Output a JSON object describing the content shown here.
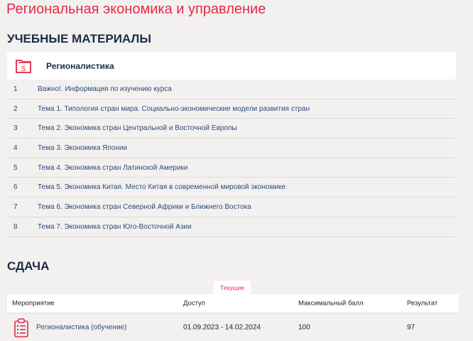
{
  "page_title": "Региональная экономика и управление",
  "materials": {
    "heading": "УЧЕБНЫЕ МАТЕРИАЛЫ",
    "course": "Регионалистика",
    "items": [
      {
        "n": "1",
        "label": "Важно!. Информация по изучению курса"
      },
      {
        "n": "2",
        "label": "Тема 1. Типология стран мира. Социально-экономические модели развития стран"
      },
      {
        "n": "3",
        "label": "Тема 2. Экономика стран Центральной и Восточной Европы"
      },
      {
        "n": "4",
        "label": "Тема 3. Экономика Японии"
      },
      {
        "n": "5",
        "label": "Тема 4. Экономика стран Латинской Америки"
      },
      {
        "n": "6",
        "label": "Тема 5. Экономика Китая. Место Китая в современной мировой экономике"
      },
      {
        "n": "7",
        "label": "Тема 6. Экономика стран Северной Африки и Ближнего Востока"
      },
      {
        "n": "8",
        "label": "Тема 7. Экономика стран Юго-Восточной Азии"
      }
    ]
  },
  "submission": {
    "heading": "СДАЧА",
    "tab": "Текущие",
    "columns": [
      "Мероприятие",
      "Доступ",
      "Максимальный балл",
      "Результат"
    ],
    "row": {
      "event": "Регионалистика (обучение)",
      "access": "01.09.2023 - 14.02.2024",
      "max": "100",
      "result": "97"
    }
  },
  "colors": {
    "accent": "#e8284a",
    "heading": "#1d2a4a",
    "link": "#2e4a7a"
  }
}
